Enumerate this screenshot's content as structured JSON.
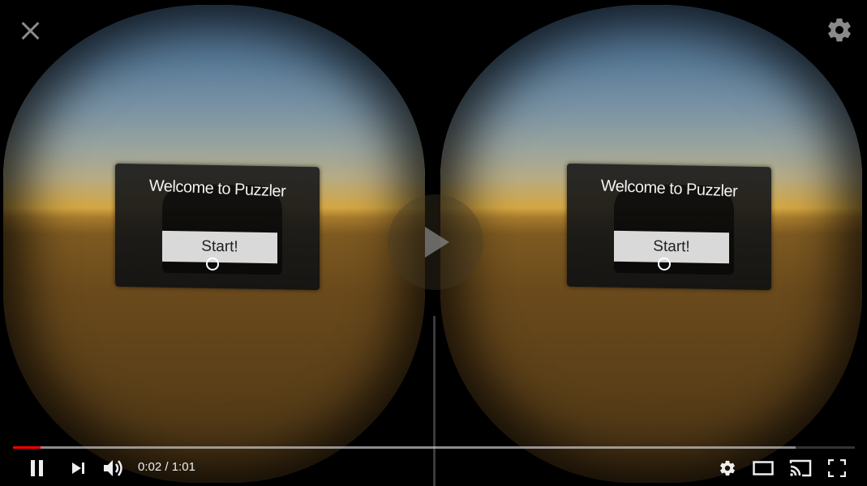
{
  "vr_scene": {
    "panel_title": "Welcome to Puzzler",
    "start_label": "Start!"
  },
  "player": {
    "time_current": "0:02",
    "time_separator": " / ",
    "time_total": "1:01",
    "progress_played_fraction": 0.033,
    "progress_loaded_fraction": 0.93,
    "accent_color": "#ff0000"
  },
  "icons": {
    "top_left": "close-icon",
    "top_right": "gear-icon",
    "center": "play-icon",
    "controls": [
      "pause-icon",
      "next-icon",
      "volume-icon",
      "settings-icon",
      "theater-mode-icon",
      "cast-icon",
      "fullscreen-icon"
    ]
  }
}
